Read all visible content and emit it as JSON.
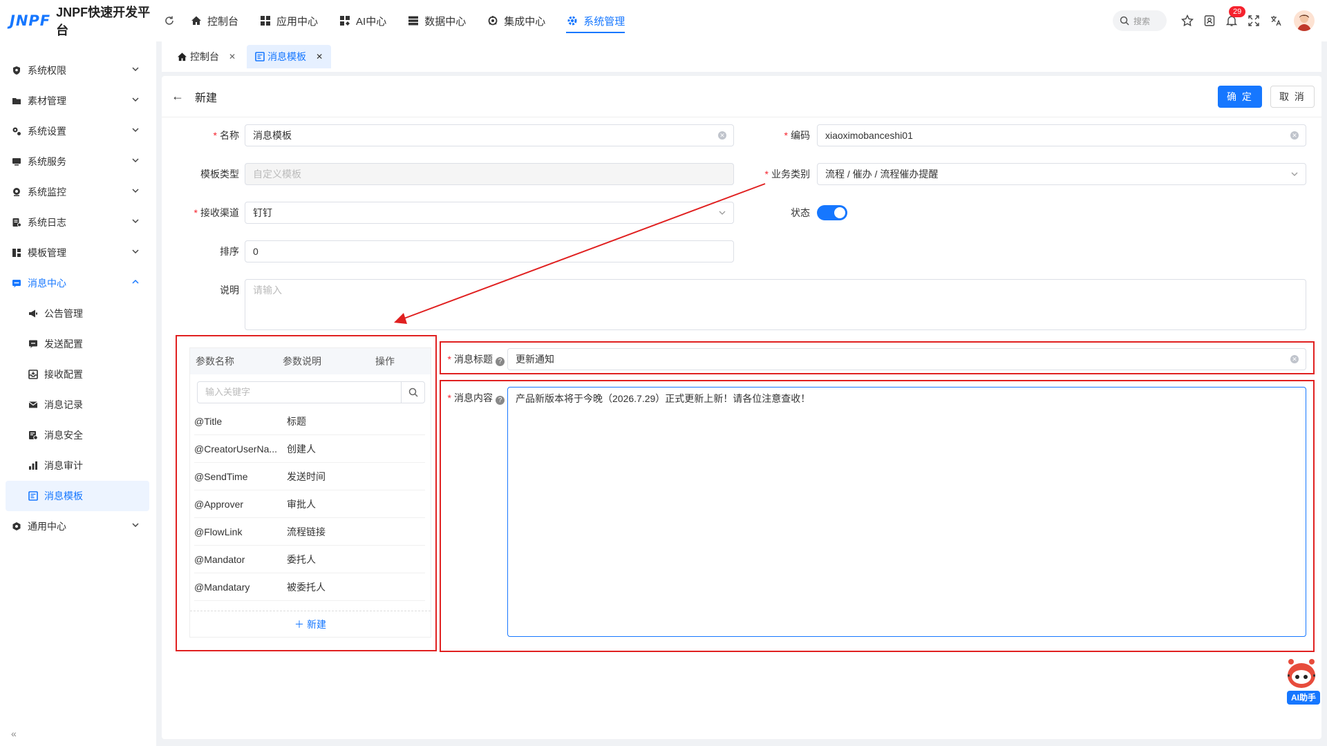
{
  "app": {
    "logo_mark": "JNPF",
    "name": "JNPF快速开发平台"
  },
  "topnav": [
    {
      "label": "控制台",
      "icon": "home-icon"
    },
    {
      "label": "应用中心",
      "icon": "apps-icon"
    },
    {
      "label": "AI中心",
      "icon": "ai-grid-icon"
    },
    {
      "label": "数据中心",
      "icon": "database-icon"
    },
    {
      "label": "集成中心",
      "icon": "integration-icon"
    },
    {
      "label": "系统管理",
      "icon": "gear-icon",
      "active": true
    }
  ],
  "top_right": {
    "search_placeholder": "搜索",
    "notification_count": "29"
  },
  "sidebar": {
    "items": [
      {
        "label": "系统权限"
      },
      {
        "label": "素材管理"
      },
      {
        "label": "系统设置"
      },
      {
        "label": "系统服务"
      },
      {
        "label": "系统监控"
      },
      {
        "label": "系统日志"
      },
      {
        "label": "模板管理"
      },
      {
        "label": "消息中心"
      },
      {
        "label": "通用中心"
      }
    ],
    "sub_items": [
      {
        "label": "公告管理"
      },
      {
        "label": "发送配置"
      },
      {
        "label": "接收配置"
      },
      {
        "label": "消息记录"
      },
      {
        "label": "消息安全"
      },
      {
        "label": "消息审计"
      },
      {
        "label": "消息模板"
      }
    ]
  },
  "tabs": [
    {
      "label": "控制台"
    },
    {
      "label": "消息模板",
      "active": true
    }
  ],
  "form": {
    "header_title": "新建",
    "ok_label": "确 定",
    "cancel_label": "取 消",
    "name_label": "名称",
    "name_value": "消息模板",
    "code_label": "编码",
    "code_value": "xiaoximobanceshi01",
    "template_type_label": "模板类型",
    "template_type_value": "自定义模板",
    "biz_category_label": "业务类别",
    "biz_category_value": "流程 / 催办 / 流程催办提醒",
    "channel_label": "接收渠道",
    "channel_value": "钉钉",
    "status_label": "状态",
    "status_on": true,
    "sort_label": "排序",
    "sort_value": "0",
    "desc_label": "说明",
    "desc_placeholder": "请输入"
  },
  "params": {
    "col_name": "参数名称",
    "col_desc": "参数说明",
    "col_action": "操作",
    "search_placeholder": "输入关键字",
    "rows": [
      {
        "name": "@Title",
        "desc": "标题"
      },
      {
        "name": "@CreatorUserNa...",
        "desc": "创建人"
      },
      {
        "name": "@SendTime",
        "desc": "发送时间"
      },
      {
        "name": "@Approver",
        "desc": "审批人"
      },
      {
        "name": "@FlowLink",
        "desc": "流程链接"
      },
      {
        "name": "@Mandator",
        "desc": "委托人"
      },
      {
        "name": "@Mandatary",
        "desc": "被委托人"
      }
    ],
    "add_label": "新建"
  },
  "message": {
    "title_label": "消息标题",
    "title_value": "更新通知",
    "content_label": "消息内容",
    "content_value": "产品新版本将于今晚（2026.7.29）正式更新上新！请各位注意查收！"
  },
  "ai_helper_label": "AI助手",
  "colors": {
    "primary": "#1677ff",
    "annotation_red": "#e02020"
  }
}
